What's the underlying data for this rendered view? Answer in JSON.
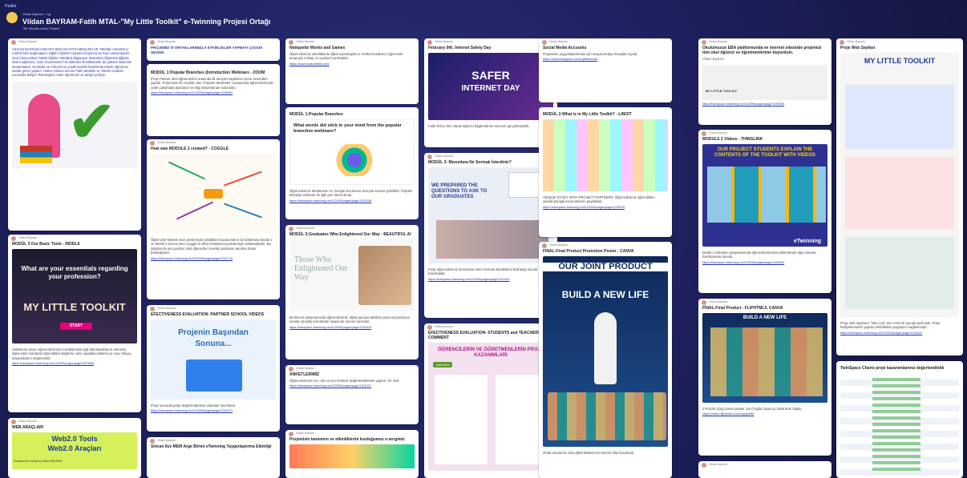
{
  "header": {
    "brand": "Padlet",
    "author": "Vildan Bayram + 4g",
    "title": "Vildan BAYRAM-Fatih MTAL-\"My Little Toolkit\" e-Twinning Projesi Ortağı",
    "subtitle": "\"Bir Sinolab Lisesi Projesi\""
  },
  "colors": {
    "background": "#1c1f5a",
    "card": "#ffffff",
    "link": "#2233aa",
    "accent_pink": "#e6007e",
    "accent_green": "#8bc34a"
  },
  "meta_author": "Vildan Bayram",
  "col1": {
    "card1_text": "VİLDAN BAYRAM-ANKARA SİNCAN FATİH MESLEKİ VE TEKNİK ANADOLU LİSESİ'nde doğmuştum. Eğitim öğretim hayatım boyunca da hep Ankara'dayım. Gazi Üniversitesi Teknik Eğitim Fakültesi Bilgisayar Sistemleri Öğretmenliğinde lisans eğitimimi, Gazi Üniversitesi Fen Bilimleri Enstitüsünde de yüksek lisansımı tamamladım. Kırıkkale ve Ankara'nın çeşitli meslek liselerinde teknik öğretmen olarak görev yaptım. Halen Ankara Sincan Fatih Mesleki ve Teknik Anadolu Lisesinde Bilişim Teknolojileri Alanı öğretmeni ve atölye şefiyim.",
    "card2_title": "MODÜL 3 Our Basic Tools - RIDDLE",
    "card2_banner": "What are your essentials regarding your profession?",
    "card2_start": "START",
    "card2_kit": "MY LITTLE TOOLKIT",
    "card2_text": "Aktivitenin amacı öğrencilerimizin meslekleriyle ilgili farkındalıklarını artırmak, öğrencileri sorularda öğrendikleri bilgilerle neler yapabileceklerini ve neye ihtiyaç duyacaklarını düşünmekti.",
    "card2_link": "https://twinspace.etwinning.net/122095/pages/page/1873069",
    "card3_title": "WEB ARAÇLARI",
    "card3_banner1": "Web2.0 Tools",
    "card3_banner2": "Web2.0 Araçları",
    "card3_footer": "Prepared the study by Vildan BAYRAM"
  },
  "col2": {
    "card1_title": "PROJEMİZ Vİ ORTAKLARIMIZLA ETKİNLİKLER YAPMAYI ÇOOOK SEVDİK",
    "card2_title": "MODÜL 1:Popular Branches (Introduction Webinars - ZOOM",
    "card2_text": "Proje Partner okul öğretmenleri arasında ilk tanışma toplantısı zoom üzerinden yapıldı. Projemizin ilk modülü olan \"Popüler Meslekler\" konusunda öğrencilerimizle ortak çalışmalar planlandı ve bilgi alışverişinde bulunuldu.",
    "card2_link": "https://twinspace.etwinning.net/122095/pages/page/1299451",
    "card3_title": "How was MODULE 2 created? - COGGLE",
    "card3_text": "Öğrenciler Meslek Alan derslerinde edindikleri kazanımların bir bölümünü Modül 2 ve Modül 3 öncesi olan Coggle ile Zihin haritalarına yöntemiyle anlatmışlardır. Bu çalışma ile tüm partner okul öğrencileri meslek alanlarını tanıtma fırsatı bulmuşlardır.",
    "card3_link": "https://twinspace.etwinning.net/122095/pages/page/1312710",
    "card4_title": "EFECTIVENESS EVALUATION- PARTNER SCHOOL VIDEOS",
    "card4_banner1": "Projenin Başından",
    "card4_banner2": "Sonuna...",
    "card4_text": "Proje sonunda proje değerlendirmesi videoları hazırlandı.",
    "card4_link": "https://twinspace.etwinning.net/122095/pages/page/1331271",
    "card5_title": "Sincan Ilçe MEM Arge Birimi eTwinning Yaygınlaştırma Etkinliği"
  },
  "col3": {
    "card1_title": "Netiquette Works and Games",
    "card1_text": "Öğrencilerimiz etkinliklerde dijital vatandaşlık ve netiket kurallarını öğrenmek amacıyla e-kitap ve oyunlar hazırladılar.",
    "card1_link": "https://www.bookcreator.com/",
    "card2_title": "MODÜL 1:Popular Branches",
    "card2_question": "What words did stick in your mind from the popular branches webinars?",
    "card2_text": "Öğrencilerimiz Mentimeter ve Google Document aracıyla sorular yöneltildi. Popüler Branşlar webinarı ile ilgili geri dönüt alındı.",
    "card2_link": "https://twinspace.etwinning.net/122095/pages/page/1307036",
    "card3_title": "MODÜL 3:Graduates Who Enlightened Our Way - BEAUTIFUL AI",
    "card3_img_text": "Those Who Enlightened Our Way",
    "card3_text": "Bir ikincisi çalışmamızda öğrencilerimiz, dijital panoya Meslek Lisesi mezunlarına sorular yöneltip sorulardan oluşan bir sunum hazırladı.",
    "card3_link": "https://twinspace.etwinning.net/122095/pages/page/1304310",
    "card4_title": "ANKETLERİMİZ",
    "card4_text": "Öğrencilerimize ön, orta ve son testlerle değerlendirmeler yapıldı. Ön Test:",
    "card4_link": "https://twinspace.etwinning.net/122095/pages/page/1331207",
    "card5_title": "Projemizin tanıtımını ve etkinliklerini kurduğumuz e-sergimiz"
  },
  "col4": {
    "card1_title": "February 9th, Internet Safety Day",
    "card1_banner1": "SAFER",
    "card1_banner2": "INTERNET DAY",
    "card1_text": "Fatih MTAL Dizi olarak öğrenci bilgilendirme seminer gerçekleştirdik.",
    "card2_title": "MODÜL 3: Mezunlara Ne Sormak İsterdiniz?",
    "card2_img_text": "WE PREPARED THE QUESTIONS TO ASK TO OUR GRADUATES",
    "card2_text": "Proje öğrencilerimiz mezunlara neler sormak istediklerini belirleyip sorular hazırladılar.",
    "card2_link": "https://twinspace.etwinning.net/122095/pages/page/1311152",
    "card3_title": "EFECTIVENESS EVALUATION- STUDENTS and TEACHERS COMMENT",
    "card3_banner": "ÖĞRENCİLERİN VE ÖĞRETMENLERİN PROJE KAZANIMLARI",
    "card3_badge": "Add Item"
  },
  "col5": {
    "card1_title": "Social Media Accounts",
    "card1_text": "Projemizin yaygınlaştırılması için sosyal medya hesapları açıldı.",
    "card1_link": "https://www.instagram.com/mylittletoolkit",
    "card2_title": "MODÜL 2:What is in My Little Toolkit? - LINOIT",
    "card2_text": "UNIQUE STUDY WITH PROJECT PARTNERS. Öğrencilerimiz öğrendikleri alanlarıyla ilgili kazanımlarını paylaştılar.",
    "card2_link": "https://twinspace.etwinning.net/122095/pages/page/1290376",
    "card3_title": "FINAL:Final Product Promotion Poster - CANVA",
    "card3_banner": "OUR JOINT PRODUCT",
    "card3_sub": "BUILD A NEW LIFE",
    "card3_text": "Ortak ürünümüz olan dijital kitabımızın tanıtım afişi hazırlandı."
  },
  "col6": {
    "card1_title": "Okulumuzun EBA platformunda ve internet sitesinde projemizi tüm okul öğrenci ve öğretmenlerime duyurdum.",
    "card1_author": "Vildan Bayram",
    "card1_logo": "MY LITTLE TOOLKIT",
    "card1_link": "https://twinspace.etwinning.net/122095/pages/page/1299455",
    "card2_title": "MODULE 2 Videos - THINGLINK",
    "card2_banner": "OUR PROJECT STUDENTS EXPLAIN THE CONTENTS OF THE TOOLKIT WITH VIDEOS",
    "card2_logo": "eTwinning",
    "card2_text": "Modül 2 videoları çalışmalarında öğrencilerimizden bölümleriyle ilgili videolar hazırlanması istendi.",
    "card2_link": "https://twinspace.etwinning.net/122095/pages/page/1493063",
    "card3_title": "FİNAL:Final Product - FLIPHTML5, CANVA",
    "card3_banner": "BUILD A NEW LIFE",
    "card3_text": "1-Puzzle Çizgi roman poster için (Tugba Oyuncu) ortak ürün bilgisi.",
    "card3_link": "https://online.fliphtml5.com/hvqsp/lefbt"
  },
  "col7": {
    "card1_title": "Proje Web Sayfası",
    "card1_banner": "MY LITTLE TOOLKIT",
    "card1_text": "Proje web sayfamız \"Wix.com\" den ANALİK ayında açılmıştır. Proje faaliyetlerinden yapılan etkinliklerin paylaşımı sağlanmıştır.",
    "card1_link": "https://twinspace.etwinning.net/122095/pages/page/1318123",
    "card2_title": "TwinSpace Charts proje kazanımlarımız değerlendirdik"
  }
}
